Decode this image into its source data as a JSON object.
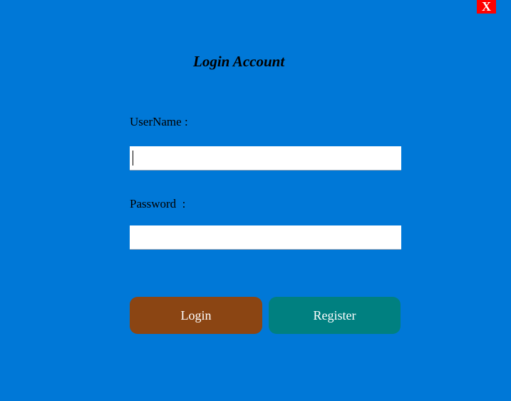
{
  "window": {
    "close_label": "X"
  },
  "form": {
    "title": "Login Account",
    "username_label": "UserName :",
    "username_value": "",
    "password_label": "Password  :",
    "password_value": "",
    "login_label": "Login",
    "register_label": "Register"
  },
  "colors": {
    "background": "#0078d7",
    "close_button": "#ff0000",
    "login_button": "#8b4513",
    "register_button": "#008080",
    "input_background": "#ffffff"
  }
}
